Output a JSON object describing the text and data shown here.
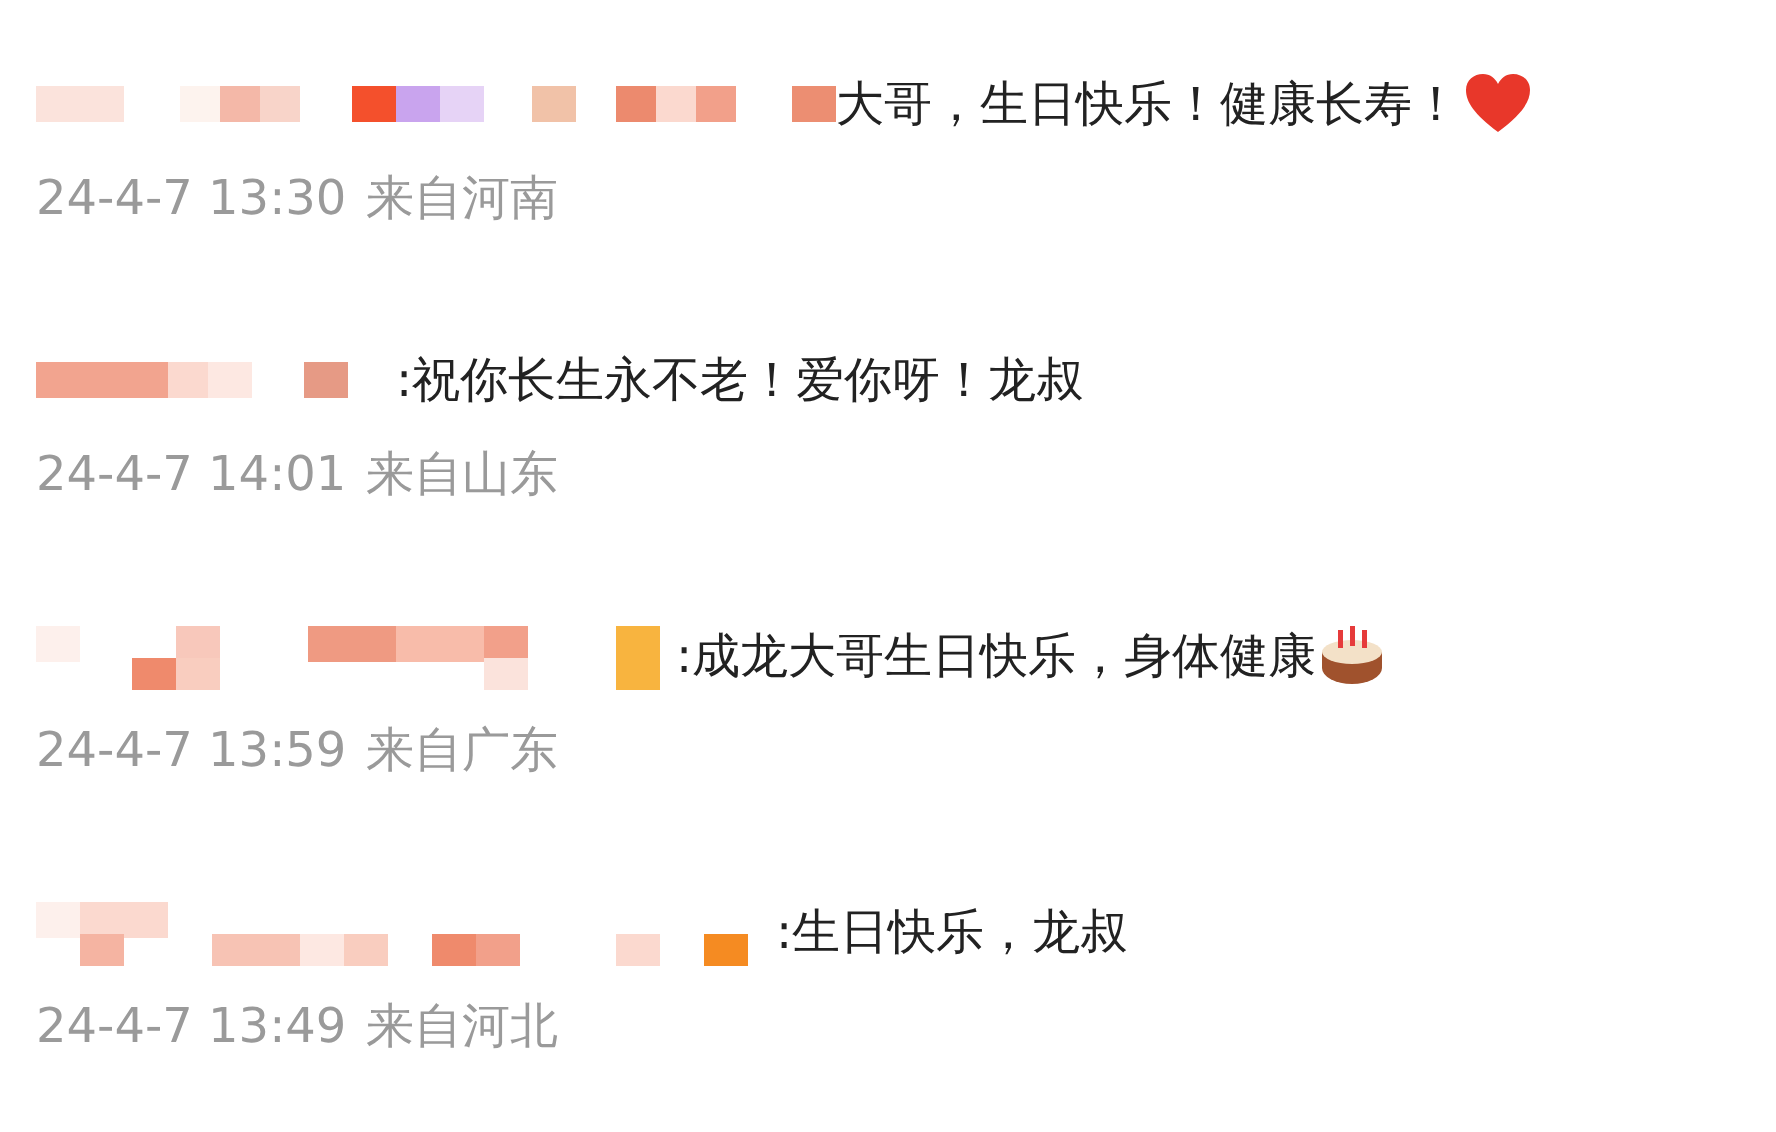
{
  "comments": [
    {
      "text": "大哥，生日快乐！健康长寿！",
      "kind": "heart",
      "time": "24-4-7 13:30",
      "location": "来自河南"
    },
    {
      "text": ":祝你长生永不老！爱你呀！龙叔",
      "time": "24-4-7 14:01",
      "location": "来自山东"
    },
    {
      "text": ":成龙大哥生日快乐，身体健康",
      "kind": "cake",
      "time": "24-4-7 13:59",
      "location": "来自广东"
    },
    {
      "text": ":生日快乐，龙叔",
      "time": "24-4-7 13:49",
      "location": "来自河北"
    }
  ]
}
